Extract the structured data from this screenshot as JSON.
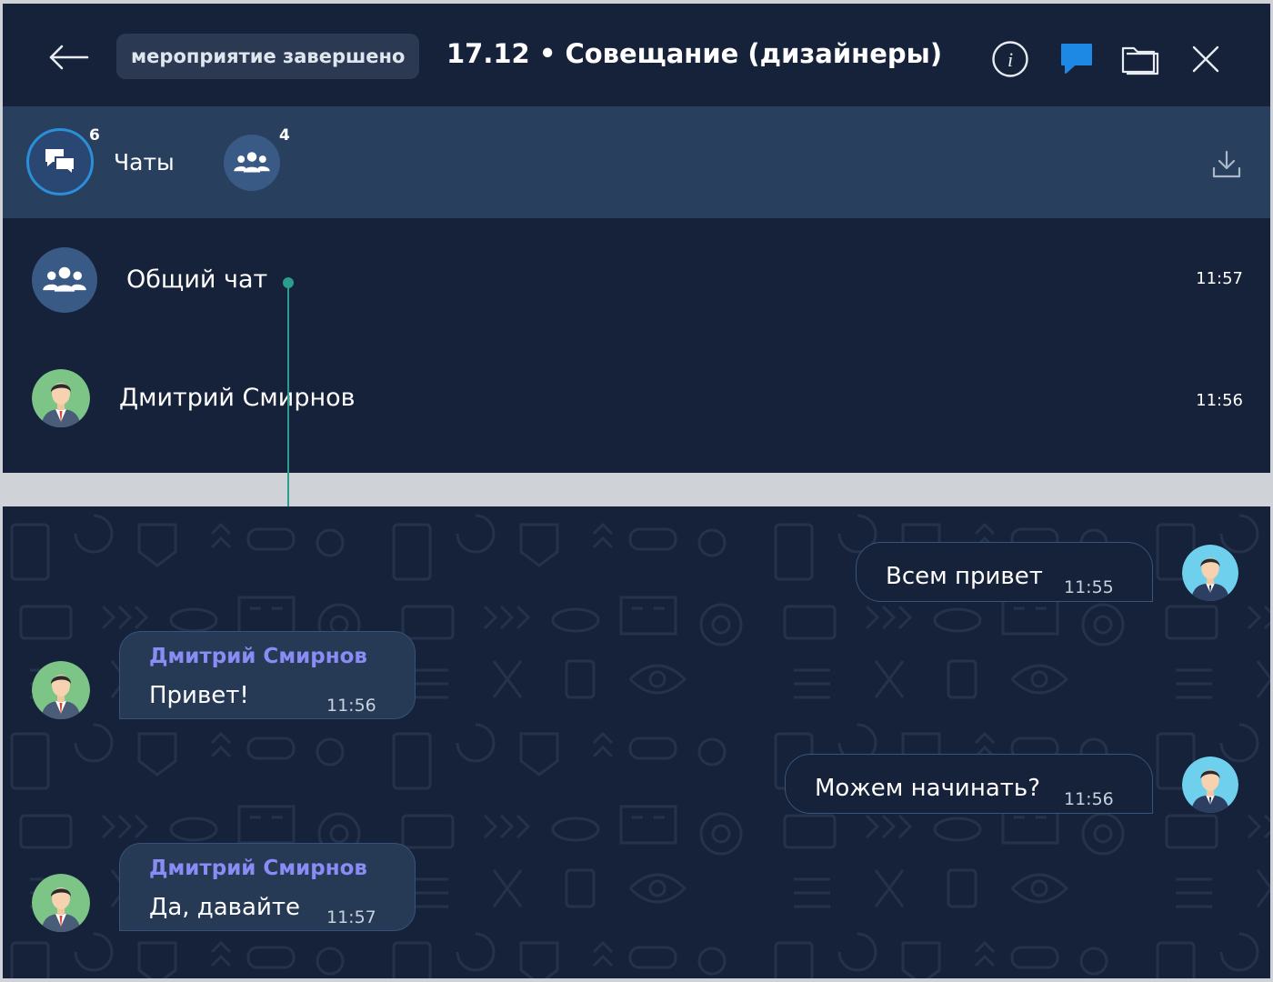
{
  "header": {
    "status": "мероприятие завершено",
    "title": "17.12 • Совещание (дизайнеры)"
  },
  "toolbar": {
    "chats_label": "Чаты",
    "chats_count": "6",
    "participants_count": "4"
  },
  "chat_list": [
    {
      "name": "Общий чат",
      "time": "11:57",
      "avatar": "group-icon"
    },
    {
      "name": "Дмитрий Смирнов",
      "time": "11:56",
      "avatar": "person-avatar"
    }
  ],
  "messages": [
    {
      "direction": "outgoing",
      "text": "Всем привет",
      "time": "11:55"
    },
    {
      "direction": "incoming",
      "sender": "Дмитрий Смирнов",
      "text": "Привет!",
      "time": "11:56"
    },
    {
      "direction": "outgoing",
      "text": "Можем начинать?",
      "time": "11:56"
    },
    {
      "direction": "incoming",
      "sender": "Дмитрий Смирнов",
      "text": "Да, давайте",
      "time": "11:57"
    }
  ],
  "colors": {
    "background": "#16213a",
    "toolbar": "#283f5e",
    "accent_chat_icon": "#1e88e5",
    "sender_name": "#8a8cf5",
    "connector": "#2a9d8f"
  }
}
